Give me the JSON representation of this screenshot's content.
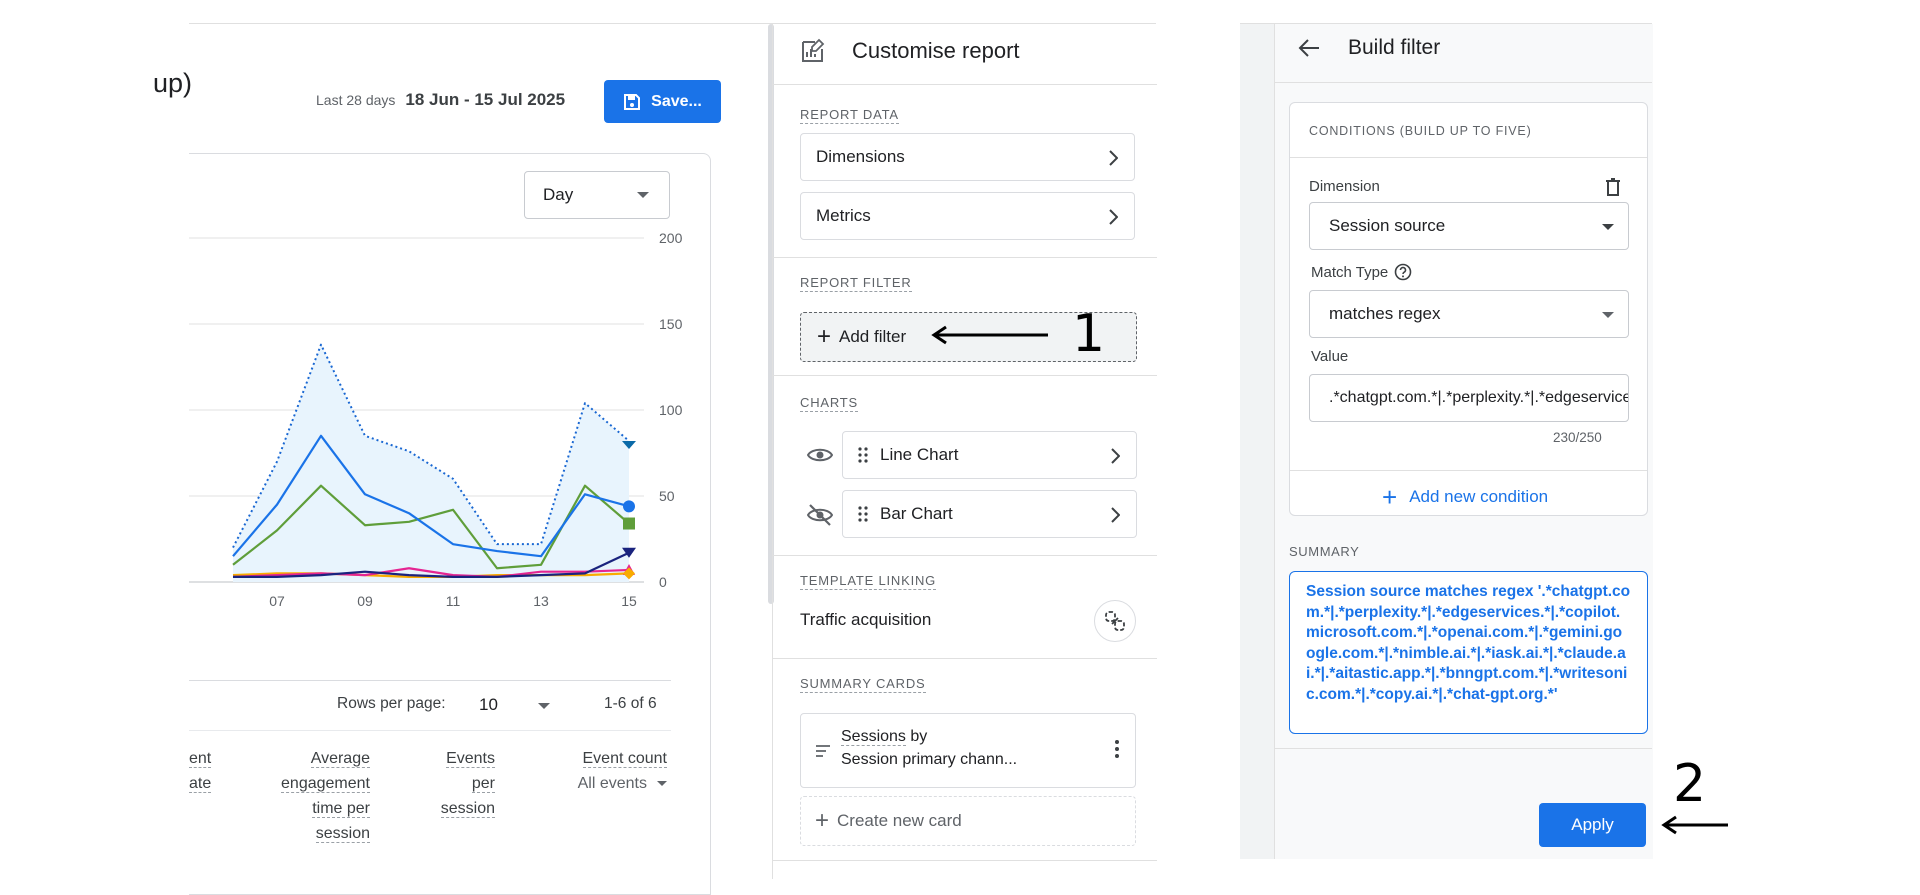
{
  "report": {
    "title_fragment": "up)",
    "date_label": "Last 28 days",
    "date_range": "18 Jun - 15 Jul 2025",
    "save_label": "Save...",
    "granularity": "Day",
    "rows_per_page_label": "Rows per page:",
    "rows_per_page_value": "10",
    "pagination": "1-6 of 6",
    "columns": [
      {
        "lines": [
          "ent",
          "ate"
        ]
      },
      {
        "lines": [
          "Average",
          "engagement",
          "time per",
          "session"
        ]
      },
      {
        "lines": [
          "Events",
          "per",
          "session"
        ]
      },
      {
        "lines": [
          "Event count"
        ],
        "sub": "All events"
      }
    ]
  },
  "chart_data": {
    "type": "line",
    "x": [
      5,
      6,
      7,
      8,
      9,
      10,
      11,
      12,
      13,
      14,
      15
    ],
    "x_tick_labels": [
      "07",
      "09",
      "11",
      "13",
      "15"
    ],
    "y_tick_labels": [
      "200",
      "150",
      "100",
      "50",
      "0"
    ],
    "ylim": [
      0,
      200
    ],
    "grid": true,
    "series": [
      {
        "color": "#1967d2",
        "style": "dotted",
        "values": [
          20,
          70,
          138,
          85,
          76,
          60,
          22,
          22,
          104,
          82
        ]
      },
      {
        "color": "#1a73e8",
        "values": [
          15,
          45,
          85,
          51,
          40,
          22,
          18,
          15,
          51,
          44
        ]
      },
      {
        "color": "#5f9e3a",
        "values": [
          10,
          30,
          56,
          33,
          35,
          42,
          8,
          10,
          56,
          34
        ]
      },
      {
        "color": "#1a237e",
        "values": [
          3,
          3,
          4,
          6,
          4,
          3,
          3,
          4,
          5,
          17
        ]
      },
      {
        "color": "#e52592",
        "values": [
          3,
          4,
          5,
          4,
          8,
          4,
          3,
          6,
          6,
          7
        ]
      },
      {
        "color": "#f9ab00",
        "values": [
          4,
          5,
          5,
          4,
          3,
          3,
          4,
          4,
          4,
          5
        ]
      }
    ]
  },
  "customise": {
    "title": "Customise report",
    "report_data_label": "REPORT DATA",
    "dimensions_label": "Dimensions",
    "metrics_label": "Metrics",
    "report_filter_label": "REPORT FILTER",
    "add_filter_label": "Add filter",
    "charts_label": "CHARTS",
    "line_chart_label": "Line Chart",
    "bar_chart_label": "Bar Chart",
    "template_linking_label": "TEMPLATE LINKING",
    "template_name": "Traffic acquisition",
    "summary_cards_label": "SUMMARY CARDS",
    "card_line1_a": "Sessions",
    "card_line1_b": " by",
    "card_line2": "Session primary chann...",
    "create_card_label": "Create new card"
  },
  "filter": {
    "title": "Build filter",
    "conditions_label": "CONDITIONS (BUILD UP TO FIVE)",
    "dimension_label": "Dimension",
    "dimension_value": "Session source",
    "match_type_label": "Match Type",
    "match_type_value": "matches regex",
    "value_label": "Value",
    "value_text": ".*chatgpt.com.*|.*perplexity.*|.*edgeservices.*|.*copilot.microsoft.com.*",
    "char_count": "230/250",
    "add_condition_label": "Add new condition",
    "summary_label": "SUMMARY",
    "summary_text": "Session source matches regex '.*chatgpt.com.*|.*perplexity.*|.*edgeservices.*|.*copilot.microsoft.com.*|.*openai.com.*|.*gemini.google.com.*|.*nimble.ai.*|.*iask.ai.*|.*claude.ai.*|.*aitastic.app.*|.*bnngpt.com.*|.*writesonic.com.*|.*copy.ai.*|.*chat-gpt.org.*'",
    "apply_label": "Apply"
  },
  "annotations": {
    "step1": "1",
    "step2": "2"
  }
}
